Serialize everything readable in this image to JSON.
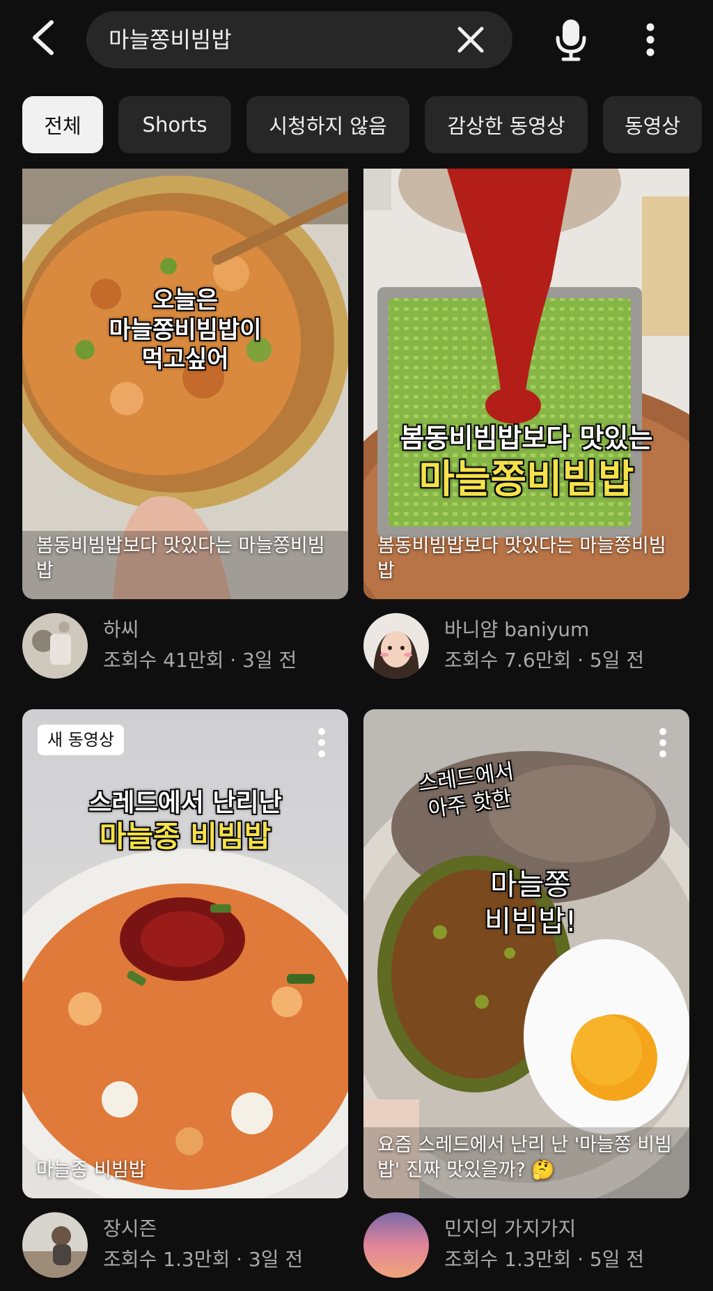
{
  "header": {
    "back_icon": "back-arrow-icon",
    "search_query": "마늘쫑비빔밥",
    "clear_icon": "close-icon",
    "mic_icon": "microphone-icon",
    "more_icon": "more-vert-icon"
  },
  "chips": [
    {
      "label": "전체",
      "active": true
    },
    {
      "label": "Shorts",
      "active": false
    },
    {
      "label": "시청하지 않음",
      "active": false
    },
    {
      "label": "감상한 동영상",
      "active": false
    },
    {
      "label": "동영상",
      "active": false
    }
  ],
  "videos": [
    {
      "overlay_lines": [
        "오늘은",
        "마늘쫑비빔밥이",
        "먹고싶어"
      ],
      "title": "봄동비빔밥보다 맛있다는 마늘쫑비빔밥",
      "channel": "하씨",
      "stats": "조회수 41만회 · 3일 전"
    },
    {
      "overlay_line1": "봄동비빔밥보다 맛있는",
      "overlay_line2": "마늘쫑비빔밥",
      "title": "봄동비빔밥보다 맛있다는 마늘쫑비빔밥",
      "channel": "바니얌 baniyum",
      "stats": "조회수 7.6만회 · 5일 전"
    },
    {
      "badge": "새 동영상",
      "overlay_line1": "스레드에서 난리난",
      "overlay_line2": "마늘종 비빔밥",
      "title": "마늘종 비빔밥",
      "channel": "장시즌",
      "stats": "조회수 1.3만회 · 3일 전"
    },
    {
      "overlay_bubble": [
        "스레드에서",
        "아주 핫한"
      ],
      "overlay_lines": [
        "마늘쫑",
        "비빔밥!"
      ],
      "title": "요즘 스레드에서 난리 난 '마늘쫑 비빔밥' 진짜 맛있을까? 🤔",
      "channel": "민지의 가지가지",
      "stats": "조회수 1.3만회 · 5일 전"
    }
  ],
  "colors": {
    "background": "#0f0f0f",
    "chip_bg": "#272727",
    "chip_active_bg": "#f1f1f1",
    "text_primary": "#f1f1f1",
    "text_secondary": "#aaaaaa",
    "overlay_yellow": "#f5e14a"
  }
}
